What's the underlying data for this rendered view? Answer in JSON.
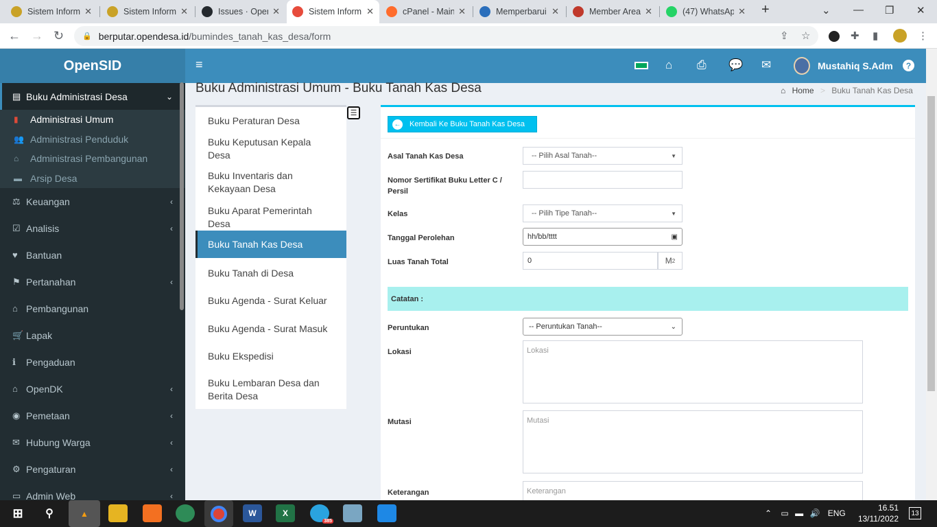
{
  "browser": {
    "tabs": [
      {
        "label": "Sistem Inform",
        "fav_color": "#c9a227"
      },
      {
        "label": "Sistem Inform",
        "fav_color": "#c9a227"
      },
      {
        "label": "Issues · Open",
        "fav_color": "#24292e"
      },
      {
        "label": "Sistem Inform",
        "fav_color": "#e74c3c"
      },
      {
        "label": "cPanel - Main",
        "fav_color": "#ff6c2c"
      },
      {
        "label": "Memperbarui",
        "fav_color": "#2a6ebb"
      },
      {
        "label": "Member Area",
        "fav_color": "#c0392b"
      },
      {
        "label": "(47) WhatsAp",
        "fav_color": "#25d366"
      }
    ],
    "url_host": "berputar.opendesa.id",
    "url_path": "/bumindes_tanah_kas_desa/form"
  },
  "sidebar": {
    "logo": "OpenSID",
    "open_section": "Buku Administrasi Desa",
    "subitems": [
      {
        "label": "Administrasi Umum",
        "icon": "bookmark-icon"
      },
      {
        "label": "Administrasi Penduduk",
        "icon": "users-icon"
      },
      {
        "label": "Administrasi Pembangunan",
        "icon": "institution-icon"
      },
      {
        "label": "Arsip Desa",
        "icon": "archive-icon"
      }
    ],
    "items": [
      {
        "label": "Keuangan",
        "icon": "balance-scale-icon",
        "glyph": "⚖",
        "chevron": true
      },
      {
        "label": "Analisis",
        "icon": "check-square-icon",
        "glyph": "☑",
        "chevron": true
      },
      {
        "label": "Bantuan",
        "icon": "heart-icon",
        "glyph": "♥",
        "chevron": false
      },
      {
        "label": "Pertanahan",
        "icon": "map-signs-icon",
        "glyph": "⚑",
        "chevron": true
      },
      {
        "label": "Pembangunan",
        "icon": "institution-icon",
        "glyph": "⌂",
        "chevron": false
      },
      {
        "label": "Lapak",
        "icon": "cart-icon",
        "glyph": "🛒",
        "chevron": false
      },
      {
        "label": "Pengaduan",
        "icon": "info-icon",
        "glyph": "ℹ",
        "chevron": false
      },
      {
        "label": "OpenDK",
        "icon": "institution-icon",
        "glyph": "⌂",
        "chevron": true
      },
      {
        "label": "Pemetaan",
        "icon": "globe-icon",
        "glyph": "◉",
        "chevron": true
      },
      {
        "label": "Hubung Warga",
        "icon": "envelope-icon",
        "glyph": "✉",
        "chevron": true
      },
      {
        "label": "Pengaturan",
        "icon": "users-icon",
        "glyph": "⚙",
        "chevron": true
      },
      {
        "label": "Admin Web",
        "icon": "desktop-icon",
        "glyph": "▭",
        "chevron": true
      }
    ]
  },
  "topnav": {
    "username": "Mustahiq S.Adm",
    "help": "?"
  },
  "page": {
    "title": "Buku Administrasi Umum - Buku Tanah Kas Desa",
    "breadcrumb_home": "Home",
    "breadcrumb_current": "Buku Tanah Kas Desa"
  },
  "menu": [
    "Buku Peraturan Desa",
    "Buku Keputusan Kepala Desa",
    "Buku Inventaris dan Kekayaan Desa",
    "Buku Aparat Pemerintah Desa",
    "Buku Tanah Kas Desa",
    "Buku Tanah di Desa",
    "Buku Agenda - Surat Keluar",
    "Buku Agenda - Surat Masuk",
    "Buku Ekspedisi",
    "Buku Lembaran Desa dan Berita Desa"
  ],
  "menu_selected_index": 4,
  "form": {
    "back_label": "Kembali Ke Buku Tanah Kas Desa",
    "asal_label": "Asal Tanah Kas Desa",
    "asal_value": "-- Pilih Asal Tanah--",
    "sertifikat_label": "Nomor Sertifikat Buku Letter C / Persil",
    "sertifikat_value": "",
    "kelas_label": "Kelas",
    "kelas_value": "-- Pilih Tipe Tanah--",
    "tanggal_label": "Tanggal Perolehan",
    "tanggal_value": "hh/bb/tttt",
    "luas_label": "Luas Tanah Total",
    "luas_value": "0",
    "luas_unit": "M",
    "luas_unit_sup": "2",
    "catatan_label": "Catatan :",
    "peruntukan_label": "Peruntukan",
    "peruntukan_value": "-- Peruntukan Tanah--",
    "lokasi_label": "Lokasi",
    "lokasi_placeholder": "Lokasi",
    "mutasi_label": "Mutasi",
    "mutasi_placeholder": "Mutasi",
    "keterangan_label": "Keterangan",
    "keterangan_placeholder": "Keterangan"
  },
  "taskbar": {
    "lang": "ENG",
    "time": "16.51",
    "date": "13/11/2022",
    "notifications": "13",
    "telegram_badge": "385"
  },
  "colors": {
    "accent": "#3c8dbc",
    "info": "#00c0ef",
    "sidebar_bg": "#222d32",
    "catatan_bg": "#a8f0ee"
  }
}
